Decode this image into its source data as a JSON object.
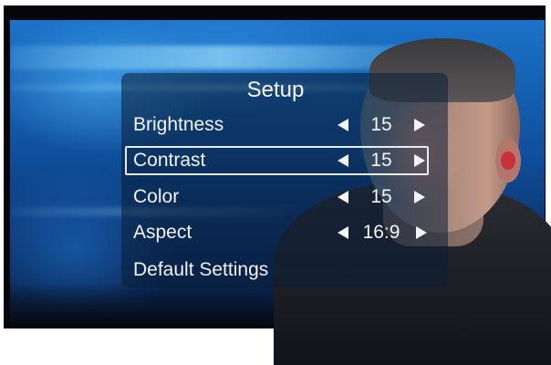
{
  "menu": {
    "title": "Setup",
    "items": [
      {
        "label": "Brightness",
        "value": "15",
        "selected": false
      },
      {
        "label": "Contrast",
        "value": "15",
        "selected": true
      },
      {
        "label": "Color",
        "value": "15",
        "selected": false
      },
      {
        "label": "Aspect",
        "value": "16:9",
        "selected": false
      },
      {
        "label": "Default Settings"
      }
    ]
  },
  "icons": {
    "decrease": "left-arrow-icon",
    "increase": "right-arrow-icon"
  },
  "colors": {
    "text": "#f2f4f6",
    "selection_border": "#e9edf1",
    "background_accent": "#1b73c9"
  }
}
